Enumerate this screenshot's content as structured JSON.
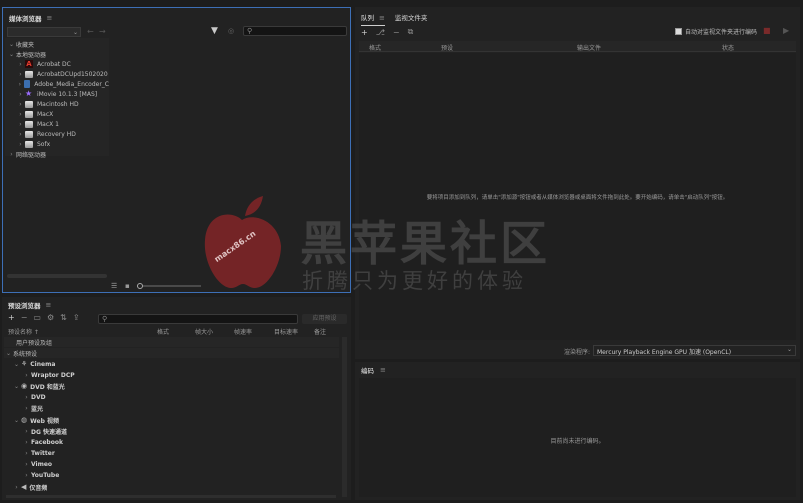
{
  "media_browser": {
    "title": "媒体浏览器",
    "sections": {
      "favorites": "收藏夹",
      "local_drives": "本地驱动器",
      "network_drives": "网络驱动器"
    },
    "drives": [
      {
        "label": "Acrobat DC",
        "icon": "acrobat-icon"
      },
      {
        "label": "AcrobatDCUpd1502020",
        "icon": "drive-icon"
      },
      {
        "label": "Adobe_Media_Encoder_C",
        "icon": "disk-image-icon"
      },
      {
        "label": "iMovie 10.1.3 [MAS]",
        "icon": "imovie-star-icon"
      },
      {
        "label": "Macintosh HD",
        "icon": "drive-icon"
      },
      {
        "label": "MacX",
        "icon": "drive-icon"
      },
      {
        "label": "MacX 1",
        "icon": "drive-icon"
      },
      {
        "label": "Recovery HD",
        "icon": "drive-icon"
      },
      {
        "label": "Sofx",
        "icon": "drive-icon"
      }
    ]
  },
  "queue": {
    "tabs": [
      "队列",
      "监视文件夹"
    ],
    "auto_encode_label": "自动对监视文件夹进行编码",
    "columns": [
      "格式",
      "预设",
      "输出文件",
      "状态"
    ],
    "empty_message": "要将项目添加到队列，请单击\"添加源\"按钮或者从媒体浏览器或桌面将文件拖到此处。要开始编码，请单击\"启动队列\"按钮。",
    "renderer_label": "渲染程序:",
    "renderer_value": "Mercury Playback Engine GPU 加速 (OpenCL)"
  },
  "encoding": {
    "title": "编码",
    "empty_message": "目前尚未进行编码。"
  },
  "preset_browser": {
    "title": "预设浏览器",
    "apply_label": "应用预设",
    "columns": [
      "预设名称 ↑",
      "格式",
      "帧大小",
      "帧速率",
      "目标速率",
      "备注"
    ],
    "user_group": "用户预设及组",
    "system_group": "系统预设",
    "items": [
      {
        "label": "Cinema",
        "level": 1,
        "open": true,
        "icon": "cinema-icon"
      },
      {
        "label": "Wraptor DCP",
        "level": 2,
        "open": false
      },
      {
        "label": "DVD 和蓝光",
        "level": 1,
        "open": true,
        "icon": "disc-icon"
      },
      {
        "label": "DVD",
        "level": 2,
        "open": false
      },
      {
        "label": "蓝光",
        "level": 2,
        "open": false
      },
      {
        "label": "Web 视频",
        "level": 1,
        "open": true,
        "icon": "globe-icon"
      },
      {
        "label": "DG 快速通道",
        "level": 2,
        "open": false
      },
      {
        "label": "Facebook",
        "level": 2,
        "open": false
      },
      {
        "label": "Twitter",
        "level": 2,
        "open": false
      },
      {
        "label": "Vimeo",
        "level": 2,
        "open": false
      },
      {
        "label": "YouTube",
        "level": 2,
        "open": false
      },
      {
        "label": "仅音频",
        "level": 1,
        "open": false,
        "icon": "speaker-icon"
      }
    ]
  },
  "watermark": {
    "site": "macx86.cn",
    "title": "黑苹果社区",
    "slogan": "折腾只为更好的体验"
  }
}
